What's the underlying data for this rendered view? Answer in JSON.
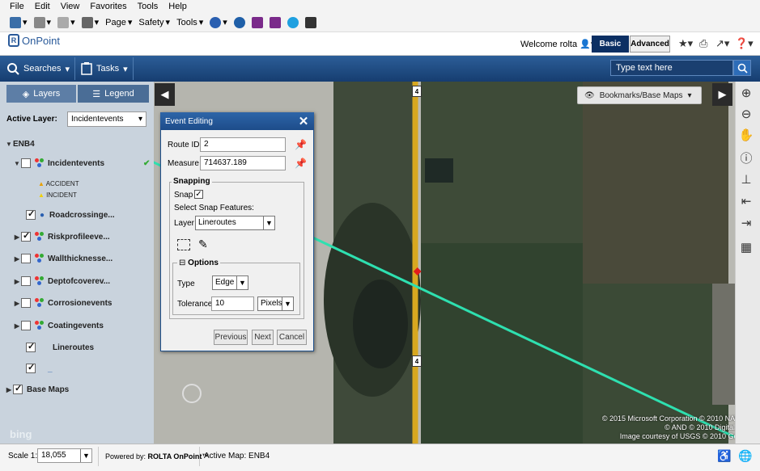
{
  "ie_menu": [
    "File",
    "Edit",
    "View",
    "Favorites",
    "Tools",
    "Help"
  ],
  "ie_toolbar": {
    "page_label": "Page",
    "safety_label": "Safety",
    "tools_label": "Tools"
  },
  "app": {
    "logo_text": "OnPoint",
    "logo_sub": "ROLTA",
    "welcome": "Welcome rolta",
    "mode_basic": "Basic",
    "mode_advanced": "Advanced"
  },
  "nav": {
    "searches_label": "Searches",
    "tasks_label": "Tasks",
    "search_placeholder": "Type text here"
  },
  "left_panel": {
    "tab_layers": "Layers",
    "tab_legend": "Legend",
    "active_layer_label": "Active Layer:",
    "active_layer_value": "Incidentevents",
    "group_name": "ENB4",
    "layers": [
      {
        "name": "Incidentevents",
        "checked": false,
        "expand": "open"
      },
      {
        "name": "Roadcrossinge...",
        "checked": true,
        "expand": "none"
      },
      {
        "name": "Riskprofileeve...",
        "checked": true,
        "expand": "closed"
      },
      {
        "name": "Wallthicknesse...",
        "checked": false,
        "expand": "closed"
      },
      {
        "name": "Deptofcoverev...",
        "checked": false,
        "expand": "closed"
      },
      {
        "name": "Corrosionevents",
        "checked": false,
        "expand": "closed"
      },
      {
        "name": "Coatingevents",
        "checked": false,
        "expand": "closed"
      },
      {
        "name": "Lineroutes",
        "checked": true,
        "expand": "none"
      },
      {
        "name": "_",
        "checked": true,
        "expand": "none"
      }
    ],
    "legend_items": [
      "ACCIDENT",
      "INCIDENT"
    ],
    "base_maps": "Base Maps"
  },
  "map": {
    "bookmarks_label": "Bookmarks/Base Maps",
    "highway_label": "4",
    "copyright_lines": [
      "© 2015 Microsoft Corporation   © 2010 NAVTEQ",
      "© AND   © 2010 DigitalGlobe",
      "Image courtesy of USGS   © 2010 GeoEye"
    ],
    "bing": "bing"
  },
  "dialog": {
    "title": "Event Editing",
    "route_id_label": "Route ID:",
    "route_id_value": "2",
    "measure_label": "Measure",
    "measure_value": "714637.189",
    "snapping_legend": "Snapping",
    "snap_label": "Snap",
    "snap_checked": true,
    "select_snap_features": "Select Snap Features:",
    "layer_label": "Layer",
    "layer_value": "Lineroutes",
    "options_legend": "Options",
    "type_label": "Type",
    "type_value": "Edge",
    "tolerance_label": "Tolerance",
    "tolerance_value": "10",
    "tolerance_unit": "Pixels",
    "btn_previous": "Previous",
    "btn_next": "Next",
    "btn_cancel": "Cancel"
  },
  "status": {
    "scale_label": "Scale 1:",
    "scale_value": "18,055",
    "powered_by": "Powered by:",
    "powered_brand": "ROLTA OnPoint™",
    "active_map": "Active Map: ENB4"
  },
  "colors": {
    "accent": "#1e4f8a",
    "route_line": "#2ee0b0",
    "road": "#d8a820"
  }
}
